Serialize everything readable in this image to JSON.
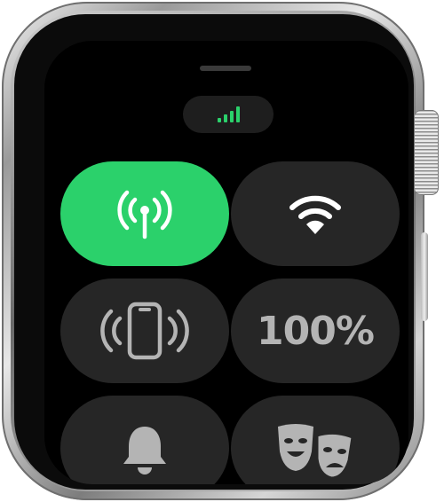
{
  "device": "Apple Watch",
  "colors": {
    "accent_green": "#2bd16b",
    "tile_background": "#262626",
    "icon_gray": "#b4b4b4",
    "cellular_active_bg": "#2bd16b"
  },
  "status": {
    "signal_bars": 4,
    "signal_color": "#2bd16b"
  },
  "tiles": [
    {
      "id": "cellular",
      "icon": "cellular-antenna-icon",
      "active": true
    },
    {
      "id": "wifi",
      "icon": "wifi-icon",
      "active": false
    },
    {
      "id": "ping-iphone",
      "icon": "ping-iphone-icon",
      "active": false
    },
    {
      "id": "battery",
      "label": "100%",
      "active": false
    },
    {
      "id": "silent-mode",
      "icon": "bell-icon",
      "active": false
    },
    {
      "id": "theater-mode",
      "icon": "theater-masks-icon",
      "active": false
    }
  ]
}
